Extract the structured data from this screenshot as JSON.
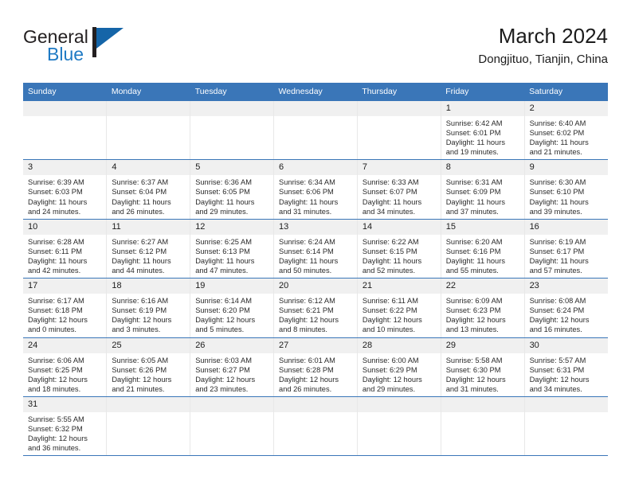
{
  "brand": {
    "name_part1": "General",
    "name_part2": "Blue",
    "flag_icon": "flag-icon",
    "colors": {
      "dark": "#231f20",
      "blue": "#1f7ac4",
      "flag": "#1565a8"
    }
  },
  "header": {
    "title": "March 2024",
    "subtitle": "Dongjituo, Tianjin, China"
  },
  "theme": {
    "header_blue": "#3a76b8",
    "daynum_band": "#f0f0f0",
    "row_divider": "#3a76b8",
    "column_divider": "#e8e8e8"
  },
  "calendar": {
    "weekday_headers": [
      "Sunday",
      "Monday",
      "Tuesday",
      "Wednesday",
      "Thursday",
      "Friday",
      "Saturday"
    ],
    "labels": {
      "sunrise": "Sunrise:",
      "sunset": "Sunset:",
      "daylight": "Daylight:"
    },
    "weeks": [
      [
        {
          "day": "",
          "empty": true,
          "sunrise": "",
          "sunset": "",
          "daylight_line1": "",
          "daylight_line2": ""
        },
        {
          "day": "",
          "empty": true,
          "sunrise": "",
          "sunset": "",
          "daylight_line1": "",
          "daylight_line2": ""
        },
        {
          "day": "",
          "empty": true,
          "sunrise": "",
          "sunset": "",
          "daylight_line1": "",
          "daylight_line2": ""
        },
        {
          "day": "",
          "empty": true,
          "sunrise": "",
          "sunset": "",
          "daylight_line1": "",
          "daylight_line2": ""
        },
        {
          "day": "",
          "empty": true,
          "sunrise": "",
          "sunset": "",
          "daylight_line1": "",
          "daylight_line2": ""
        },
        {
          "day": "1",
          "empty": false,
          "sunrise": "Sunrise: 6:42 AM",
          "sunset": "Sunset: 6:01 PM",
          "daylight_line1": "Daylight: 11 hours",
          "daylight_line2": "and 19 minutes."
        },
        {
          "day": "2",
          "empty": false,
          "sunrise": "Sunrise: 6:40 AM",
          "sunset": "Sunset: 6:02 PM",
          "daylight_line1": "Daylight: 11 hours",
          "daylight_line2": "and 21 minutes."
        }
      ],
      [
        {
          "day": "3",
          "empty": false,
          "sunrise": "Sunrise: 6:39 AM",
          "sunset": "Sunset: 6:03 PM",
          "daylight_line1": "Daylight: 11 hours",
          "daylight_line2": "and 24 minutes."
        },
        {
          "day": "4",
          "empty": false,
          "sunrise": "Sunrise: 6:37 AM",
          "sunset": "Sunset: 6:04 PM",
          "daylight_line1": "Daylight: 11 hours",
          "daylight_line2": "and 26 minutes."
        },
        {
          "day": "5",
          "empty": false,
          "sunrise": "Sunrise: 6:36 AM",
          "sunset": "Sunset: 6:05 PM",
          "daylight_line1": "Daylight: 11 hours",
          "daylight_line2": "and 29 minutes."
        },
        {
          "day": "6",
          "empty": false,
          "sunrise": "Sunrise: 6:34 AM",
          "sunset": "Sunset: 6:06 PM",
          "daylight_line1": "Daylight: 11 hours",
          "daylight_line2": "and 31 minutes."
        },
        {
          "day": "7",
          "empty": false,
          "sunrise": "Sunrise: 6:33 AM",
          "sunset": "Sunset: 6:07 PM",
          "daylight_line1": "Daylight: 11 hours",
          "daylight_line2": "and 34 minutes."
        },
        {
          "day": "8",
          "empty": false,
          "sunrise": "Sunrise: 6:31 AM",
          "sunset": "Sunset: 6:09 PM",
          "daylight_line1": "Daylight: 11 hours",
          "daylight_line2": "and 37 minutes."
        },
        {
          "day": "9",
          "empty": false,
          "sunrise": "Sunrise: 6:30 AM",
          "sunset": "Sunset: 6:10 PM",
          "daylight_line1": "Daylight: 11 hours",
          "daylight_line2": "and 39 minutes."
        }
      ],
      [
        {
          "day": "10",
          "empty": false,
          "sunrise": "Sunrise: 6:28 AM",
          "sunset": "Sunset: 6:11 PM",
          "daylight_line1": "Daylight: 11 hours",
          "daylight_line2": "and 42 minutes."
        },
        {
          "day": "11",
          "empty": false,
          "sunrise": "Sunrise: 6:27 AM",
          "sunset": "Sunset: 6:12 PM",
          "daylight_line1": "Daylight: 11 hours",
          "daylight_line2": "and 44 minutes."
        },
        {
          "day": "12",
          "empty": false,
          "sunrise": "Sunrise: 6:25 AM",
          "sunset": "Sunset: 6:13 PM",
          "daylight_line1": "Daylight: 11 hours",
          "daylight_line2": "and 47 minutes."
        },
        {
          "day": "13",
          "empty": false,
          "sunrise": "Sunrise: 6:24 AM",
          "sunset": "Sunset: 6:14 PM",
          "daylight_line1": "Daylight: 11 hours",
          "daylight_line2": "and 50 minutes."
        },
        {
          "day": "14",
          "empty": false,
          "sunrise": "Sunrise: 6:22 AM",
          "sunset": "Sunset: 6:15 PM",
          "daylight_line1": "Daylight: 11 hours",
          "daylight_line2": "and 52 minutes."
        },
        {
          "day": "15",
          "empty": false,
          "sunrise": "Sunrise: 6:20 AM",
          "sunset": "Sunset: 6:16 PM",
          "daylight_line1": "Daylight: 11 hours",
          "daylight_line2": "and 55 minutes."
        },
        {
          "day": "16",
          "empty": false,
          "sunrise": "Sunrise: 6:19 AM",
          "sunset": "Sunset: 6:17 PM",
          "daylight_line1": "Daylight: 11 hours",
          "daylight_line2": "and 57 minutes."
        }
      ],
      [
        {
          "day": "17",
          "empty": false,
          "sunrise": "Sunrise: 6:17 AM",
          "sunset": "Sunset: 6:18 PM",
          "daylight_line1": "Daylight: 12 hours",
          "daylight_line2": "and 0 minutes."
        },
        {
          "day": "18",
          "empty": false,
          "sunrise": "Sunrise: 6:16 AM",
          "sunset": "Sunset: 6:19 PM",
          "daylight_line1": "Daylight: 12 hours",
          "daylight_line2": "and 3 minutes."
        },
        {
          "day": "19",
          "empty": false,
          "sunrise": "Sunrise: 6:14 AM",
          "sunset": "Sunset: 6:20 PM",
          "daylight_line1": "Daylight: 12 hours",
          "daylight_line2": "and 5 minutes."
        },
        {
          "day": "20",
          "empty": false,
          "sunrise": "Sunrise: 6:12 AM",
          "sunset": "Sunset: 6:21 PM",
          "daylight_line1": "Daylight: 12 hours",
          "daylight_line2": "and 8 minutes."
        },
        {
          "day": "21",
          "empty": false,
          "sunrise": "Sunrise: 6:11 AM",
          "sunset": "Sunset: 6:22 PM",
          "daylight_line1": "Daylight: 12 hours",
          "daylight_line2": "and 10 minutes."
        },
        {
          "day": "22",
          "empty": false,
          "sunrise": "Sunrise: 6:09 AM",
          "sunset": "Sunset: 6:23 PM",
          "daylight_line1": "Daylight: 12 hours",
          "daylight_line2": "and 13 minutes."
        },
        {
          "day": "23",
          "empty": false,
          "sunrise": "Sunrise: 6:08 AM",
          "sunset": "Sunset: 6:24 PM",
          "daylight_line1": "Daylight: 12 hours",
          "daylight_line2": "and 16 minutes."
        }
      ],
      [
        {
          "day": "24",
          "empty": false,
          "sunrise": "Sunrise: 6:06 AM",
          "sunset": "Sunset: 6:25 PM",
          "daylight_line1": "Daylight: 12 hours",
          "daylight_line2": "and 18 minutes."
        },
        {
          "day": "25",
          "empty": false,
          "sunrise": "Sunrise: 6:05 AM",
          "sunset": "Sunset: 6:26 PM",
          "daylight_line1": "Daylight: 12 hours",
          "daylight_line2": "and 21 minutes."
        },
        {
          "day": "26",
          "empty": false,
          "sunrise": "Sunrise: 6:03 AM",
          "sunset": "Sunset: 6:27 PM",
          "daylight_line1": "Daylight: 12 hours",
          "daylight_line2": "and 23 minutes."
        },
        {
          "day": "27",
          "empty": false,
          "sunrise": "Sunrise: 6:01 AM",
          "sunset": "Sunset: 6:28 PM",
          "daylight_line1": "Daylight: 12 hours",
          "daylight_line2": "and 26 minutes."
        },
        {
          "day": "28",
          "empty": false,
          "sunrise": "Sunrise: 6:00 AM",
          "sunset": "Sunset: 6:29 PM",
          "daylight_line1": "Daylight: 12 hours",
          "daylight_line2": "and 29 minutes."
        },
        {
          "day": "29",
          "empty": false,
          "sunrise": "Sunrise: 5:58 AM",
          "sunset": "Sunset: 6:30 PM",
          "daylight_line1": "Daylight: 12 hours",
          "daylight_line2": "and 31 minutes."
        },
        {
          "day": "30",
          "empty": false,
          "sunrise": "Sunrise: 5:57 AM",
          "sunset": "Sunset: 6:31 PM",
          "daylight_line1": "Daylight: 12 hours",
          "daylight_line2": "and 34 minutes."
        }
      ],
      [
        {
          "day": "31",
          "empty": false,
          "sunrise": "Sunrise: 5:55 AM",
          "sunset": "Sunset: 6:32 PM",
          "daylight_line1": "Daylight: 12 hours",
          "daylight_line2": "and 36 minutes."
        },
        {
          "day": "",
          "empty": true,
          "sunrise": "",
          "sunset": "",
          "daylight_line1": "",
          "daylight_line2": ""
        },
        {
          "day": "",
          "empty": true,
          "sunrise": "",
          "sunset": "",
          "daylight_line1": "",
          "daylight_line2": ""
        },
        {
          "day": "",
          "empty": true,
          "sunrise": "",
          "sunset": "",
          "daylight_line1": "",
          "daylight_line2": ""
        },
        {
          "day": "",
          "empty": true,
          "sunrise": "",
          "sunset": "",
          "daylight_line1": "",
          "daylight_line2": ""
        },
        {
          "day": "",
          "empty": true,
          "sunrise": "",
          "sunset": "",
          "daylight_line1": "",
          "daylight_line2": ""
        },
        {
          "day": "",
          "empty": true,
          "sunrise": "",
          "sunset": "",
          "daylight_line1": "",
          "daylight_line2": ""
        }
      ]
    ]
  }
}
